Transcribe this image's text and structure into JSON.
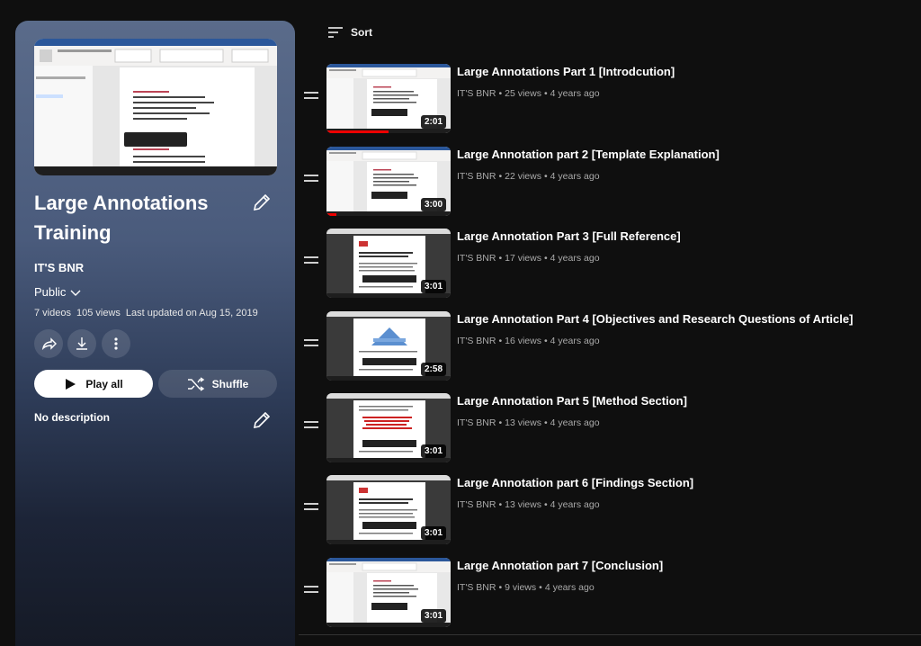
{
  "playlist": {
    "title": "Large Annotations Training",
    "owner": "IT'S BNR",
    "privacy": "Public",
    "video_count": "7 videos",
    "views": "105 views",
    "updated": "Last updated on Aug 15, 2019",
    "play_all_label": "Play all",
    "shuffle_label": "Shuffle",
    "description": "No description"
  },
  "sort_label": "Sort",
  "videos": [
    {
      "title": "Large Annotations Part 1 [Introdcution]",
      "channel": "IT'S BNR",
      "views": "25 views",
      "age": "4 years ago",
      "duration": "2:01",
      "thumb": "word",
      "watched": 0.5
    },
    {
      "title": "Large Annotation part 2 [Template Explanation]",
      "channel": "IT'S BNR",
      "views": "22 views",
      "age": "4 years ago",
      "duration": "3:00",
      "thumb": "word",
      "watched": 0.08
    },
    {
      "title": "Large Annotation Part 3 [Full Reference]",
      "channel": "IT'S BNR",
      "views": "17 views",
      "age": "4 years ago",
      "duration": "3:01",
      "thumb": "pdf",
      "watched": 0
    },
    {
      "title": "Large Annotation Part 4 [Objectives and Research Questions of Article]",
      "channel": "IT'S BNR",
      "views": "16 views",
      "age": "4 years ago",
      "duration": "2:58",
      "thumb": "pyramid",
      "watched": 0
    },
    {
      "title": "Large Annotation Part 5 [Method Section]",
      "channel": "IT'S BNR",
      "views": "13 views",
      "age": "4 years ago",
      "duration": "3:01",
      "thumb": "pdfred",
      "watched": 0
    },
    {
      "title": "Large Annotation part 6 [Findings Section]",
      "channel": "IT'S BNR",
      "views": "13 views",
      "age": "4 years ago",
      "duration": "3:01",
      "thumb": "pdf",
      "watched": 0
    },
    {
      "title": "Large Annotation part 7 [Conclusion]",
      "channel": "IT'S BNR",
      "views": "9 views",
      "age": "4 years ago",
      "duration": "3:01",
      "thumb": "word",
      "watched": 0
    }
  ]
}
